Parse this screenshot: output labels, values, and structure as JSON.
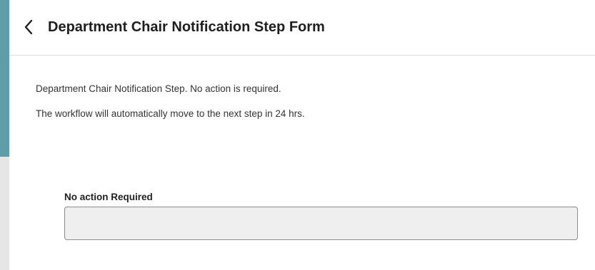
{
  "header": {
    "title": "Department Chair Notification Step Form",
    "back_icon": "chevron-left-icon"
  },
  "content": {
    "line1": "Department Chair Notification Step. No action is required.",
    "line2": "The workflow will automatically move to the next step in 24 hrs."
  },
  "field": {
    "label": "No action Required",
    "value": ""
  },
  "colors": {
    "backdrop_top": "#5f9ea8",
    "backdrop_bottom": "#e6e6e6",
    "panel": "#ffffff",
    "input_bg": "#efefef"
  }
}
